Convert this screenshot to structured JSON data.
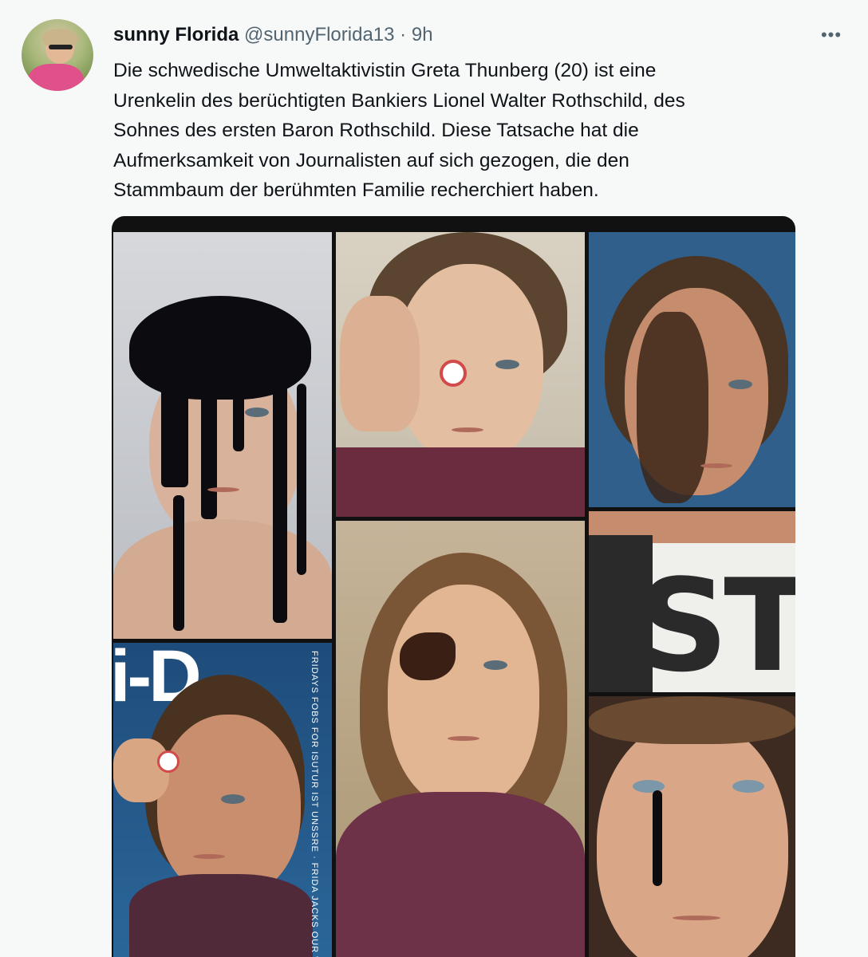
{
  "tweet": {
    "display_name": "sunny Florida",
    "handle": "@sunnyFlorida13",
    "separator": "·",
    "time": "9h",
    "more_icon": "more-horizontal-icon",
    "text_lines": [
      "Die schwedische Umweltaktivistin Greta Thunberg (20) ist eine",
      "Urenkelin des berüchtigten Bankiers Lionel Walter Rothschild, des",
      "Sohnes des ersten Baron Rothschild. Diese Tatsache hat die",
      "Aufmerksamkeit von Journalisten auf sich gezogen, die den",
      "Stammbaum der berühmten Familie recherchiert haben."
    ]
  },
  "media": {
    "cover": {
      "logo": "i-D",
      "vertical_text": "FRIDAYS FOBS FOR ISUTUR IST UNSSRE · FRIDA JACKS OUR WELT"
    },
    "sign_text": "ST"
  }
}
